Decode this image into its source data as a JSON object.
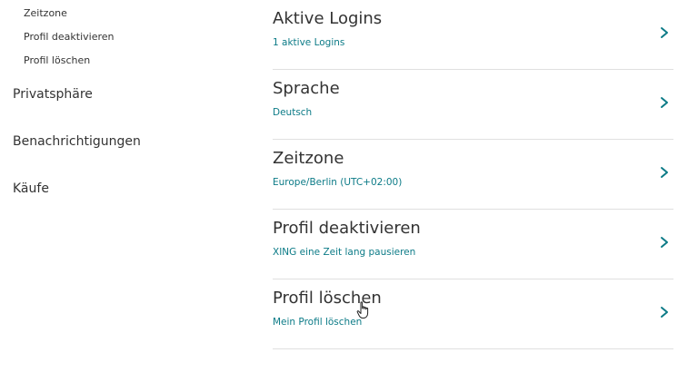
{
  "sidebar": {
    "subitems": [
      "Zeitzone",
      "Profil deaktivieren",
      "Profil löschen"
    ],
    "items": [
      "Privatsphäre",
      "Benachrichtigungen",
      "Käufe"
    ]
  },
  "main": {
    "rows": [
      {
        "title": "Aktive Logins",
        "subtitle": "1 aktive Logins"
      },
      {
        "title": "Sprache",
        "subtitle": "Deutsch"
      },
      {
        "title": "Zeitzone",
        "subtitle": "Europe/Berlin (UTC+02:00)"
      },
      {
        "title": "Profil deaktivieren",
        "subtitle": "XING eine Zeit lang pausieren"
      },
      {
        "title": "Profil löschen",
        "subtitle": "Mein Profil löschen"
      }
    ]
  },
  "colors": {
    "accent": "#0c7b87",
    "divider": "#e0e0e0",
    "text": "#333333"
  },
  "icons": {
    "row_chevron": "chevron-right-icon",
    "cursor": "hand-pointer-icon"
  }
}
